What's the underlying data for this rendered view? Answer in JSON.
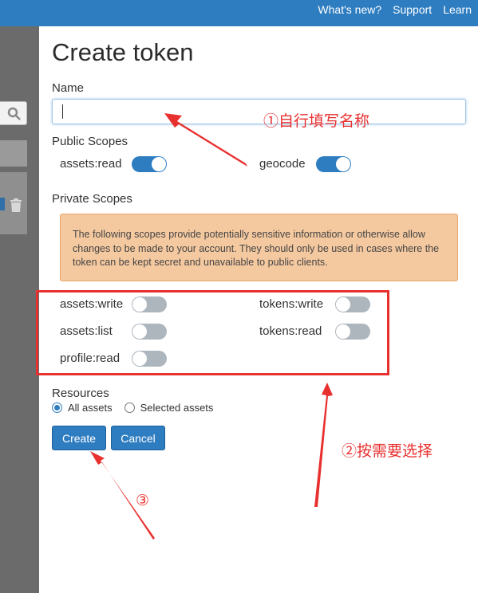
{
  "topnav": {
    "whats_new": "What's new?",
    "support": "Support",
    "learn": "Learn"
  },
  "dialog": {
    "title": "Create token",
    "name_label": "Name",
    "name_value": "",
    "public_scopes_label": "Public Scopes",
    "public_scopes": [
      {
        "label": "assets:read",
        "enabled": true
      },
      {
        "label": "geocode",
        "enabled": true
      }
    ],
    "private_scopes_label": "Private Scopes",
    "warning_text": "The following scopes provide potentially sensitive information or otherwise allow changes to be made to your account. They should only be used in cases where the token can be kept secret and unavailable to public clients.",
    "private_scopes": [
      {
        "label": "assets:write",
        "enabled": false
      },
      {
        "label": "tokens:write",
        "enabled": false
      },
      {
        "label": "assets:list",
        "enabled": false
      },
      {
        "label": "tokens:read",
        "enabled": false
      },
      {
        "label": "profile:read",
        "enabled": false
      }
    ],
    "resources_label": "Resources",
    "resources_options": [
      {
        "label": "All assets",
        "selected": true
      },
      {
        "label": "Selected assets",
        "selected": false
      }
    ],
    "create_button": "Create",
    "cancel_button": "Cancel"
  },
  "annotations": {
    "step1": "①自行填写名称",
    "step2": "②按需要选择",
    "step3": "③"
  },
  "colors": {
    "primary": "#2e7dc1",
    "toggle_off": "#adb5bd",
    "warning_bg": "#f5c9a0",
    "annotation_red": "#e8302f",
    "overlay": "#6b6b6b"
  }
}
